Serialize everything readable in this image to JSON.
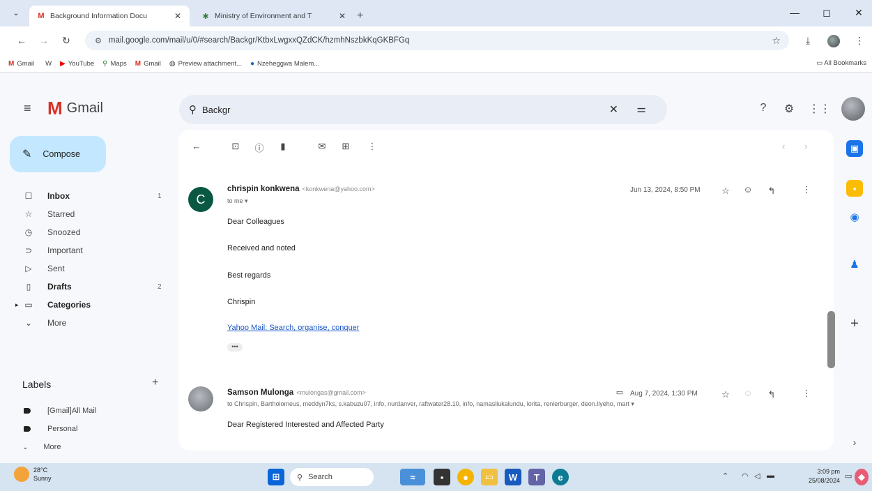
{
  "browser": {
    "tabs": [
      {
        "favicon": "gmail-icon",
        "title": "Background Information Docu",
        "active": true
      },
      {
        "favicon": "gov-icon",
        "title": "Ministry of Environment and T",
        "active": false
      }
    ],
    "url": "mail.google.com/mail/u/0/#search/Backgr/KtbxLwgxxQZdCK/hzmhNszbkKqGKBFGq",
    "bookmarks": [
      "Gmail",
      "W",
      "YouTube",
      "Maps",
      "Gmail",
      "Preview attachment...",
      "Nzeheggwa Malem..."
    ],
    "all_bookmarks": "All Bookmarks"
  },
  "gmail": {
    "logo_text": "Gmail",
    "search_value": "Backgr",
    "compose_label": "Compose",
    "nav": [
      {
        "label": "Inbox",
        "count": "1",
        "icon": "inbox-icon",
        "glyph": "☐",
        "bold": true
      },
      {
        "label": "Starred",
        "count": "",
        "icon": "star-icon",
        "glyph": "☆",
        "bold": false
      },
      {
        "label": "Snoozed",
        "count": "",
        "icon": "clock-icon",
        "glyph": "◷",
        "bold": false
      },
      {
        "label": "Important",
        "count": "",
        "icon": "important-icon",
        "glyph": "⊃",
        "bold": false
      },
      {
        "label": "Sent",
        "count": "",
        "icon": "sent-icon",
        "glyph": "▷",
        "bold": false
      },
      {
        "label": "Drafts",
        "count": "2",
        "icon": "draft-icon",
        "glyph": "▯",
        "bold": true
      },
      {
        "label": "Categories",
        "count": "",
        "icon": "label-outline-icon",
        "glyph": "▭",
        "bold": true
      },
      {
        "label": "More",
        "count": "",
        "icon": "chevron-down-icon",
        "glyph": "⌄",
        "bold": false
      }
    ],
    "labels_header": "Labels",
    "labels": [
      {
        "label": "[Gmail]All Mail",
        "icon": "label-icon"
      },
      {
        "label": "Personal",
        "icon": "label-icon"
      },
      {
        "label": "More",
        "icon": "chevron-down-icon"
      }
    ]
  },
  "messages": [
    {
      "sender": "chrispin konkwena",
      "email": "<konkwena@yahoo.com>",
      "to": "to me ▾",
      "date": "Jun 13, 2024, 8:50 PM",
      "avatar_letter": "C",
      "body": [
        "Dear Colleagues",
        "Received and noted",
        "Best regards",
        "Chrispin"
      ],
      "link": "Yahoo Mail: Search, organise, conquer",
      "dots": "•••"
    },
    {
      "sender": "Samson Mulonga",
      "email": "<mulongas@gmail.com>",
      "to": "to Chrispin, Bartholomeus, meddyn7ks, s.kabuzu07, info, nurdanver, raftwater28.10, info, namasliukalundu, lorita, renierburger, deon.liyeho, mart ▾",
      "date": "Aug 7, 2024, 1:30 PM",
      "body": [
        "Dear Registered Interested and Affected Party"
      ]
    }
  ],
  "taskbar": {
    "temp": "28°C",
    "weather": "Sunny",
    "search": "Search",
    "time": "3:09 pm",
    "date": "25/08/2024"
  }
}
